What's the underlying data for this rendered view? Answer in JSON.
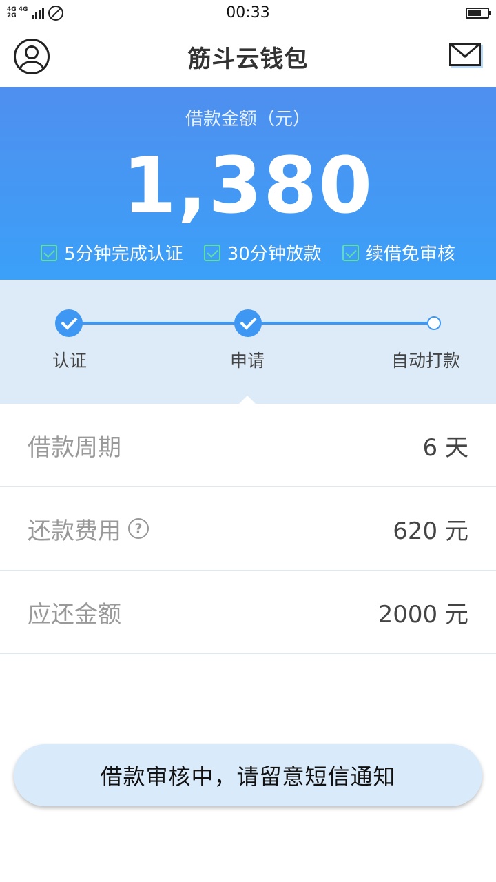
{
  "status_bar": {
    "network_top": "4G 4G",
    "network_bottom": "2G",
    "time": "00:33",
    "battery_level": 0.7
  },
  "header": {
    "title": "筋斗云钱包",
    "left_icon": "user-avatar-icon",
    "right_icon": "mail-icon"
  },
  "hero": {
    "label": "借款金额（元）",
    "amount": "1,380",
    "features": [
      {
        "label": "5分钟完成认证"
      },
      {
        "label": "30分钟放款"
      },
      {
        "label": "续借免审核"
      }
    ],
    "colors": {
      "gradient_top": "#4f8fef",
      "gradient_bottom": "#3ba0f8",
      "check": "#5fe0a6"
    }
  },
  "progress": {
    "steps": [
      {
        "label": "认证",
        "done": true
      },
      {
        "label": "申请",
        "done": true
      },
      {
        "label": "自动打款",
        "done": false
      }
    ],
    "accent": "#3e97f3"
  },
  "details": {
    "rows": [
      {
        "label": "借款周期",
        "value": "6 天"
      },
      {
        "label": "还款费用",
        "value": "620 元",
        "help": "?"
      },
      {
        "label": "应还金额",
        "value": "2000 元"
      }
    ]
  },
  "status_button": {
    "label": "借款审核中，请留意短信通知"
  }
}
